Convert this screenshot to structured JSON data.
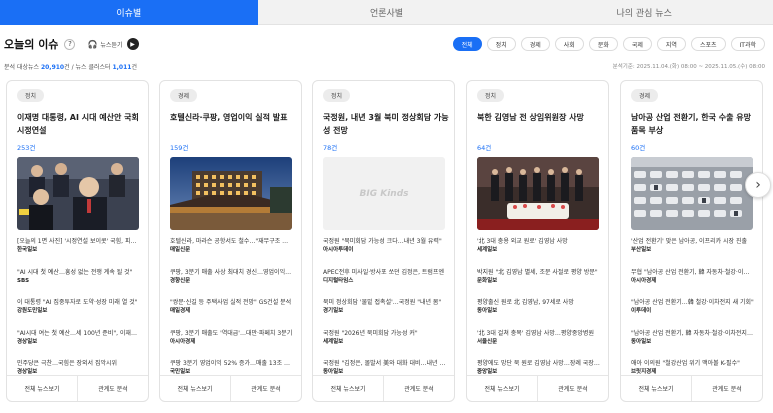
{
  "tabs": [
    {
      "label": "이슈별",
      "active": true
    },
    {
      "label": "언론사별",
      "active": false
    },
    {
      "label": "나의 관심 뉴스",
      "active": false
    }
  ],
  "heading": {
    "title": "오늘의 이슈",
    "help": "?",
    "listen": "뉴스듣기"
  },
  "categories": [
    "전체",
    "정치",
    "경제",
    "사회",
    "문화",
    "국제",
    "지역",
    "스포츠",
    "IT과학"
  ],
  "stats": {
    "label_news": "분석 대상뉴스",
    "news_count": "20,910",
    "label_cluster": "/ 뉴스 클러스터",
    "cluster_count": "1,011",
    "unit": "건",
    "basis": "분석기준: 2025.11.04.(화) 08:00 ~ 2025.11.05.(수) 08:00"
  },
  "footer": {
    "all_news": "전체 뉴스보기",
    "analysis": "관계도 분석"
  },
  "cards": [
    {
      "category": "정치",
      "title": "이재명 대통령, AI 시대 예산안 국회 시정연설",
      "count": "253건",
      "items": [
        {
          "headline": "[오늘의 1면 사진] '시정연설 보이콧' 국힘, 피켓 시위",
          "source": "한국일보"
        },
        {
          "headline": "\"AI 시대 첫 예산…흥성 없는 전쟁 계속 될 것\"",
          "source": "SBS"
        },
        {
          "headline": "이 대통령 \"AI 집중투자로 도약·성장 미래 열 것\"",
          "source": "강원도민일보"
        },
        {
          "headline": "\"AI시대 여는 첫 예산…세 100년 준비\", 이재명 대통령",
          "source": "경상일보"
        },
        {
          "headline": "민주당은 극찬…국힘은 장외서 집악시위",
          "source": "경상일보"
        }
      ]
    },
    {
      "category": "경제",
      "title": "호텔신라·쿠팡, 영업이익 실적 발표",
      "count": "159건",
      "items": [
        {
          "headline": "호텔신라, 마라슨 공항서도 철수…\"재무구조 개선\"",
          "source": "매일신문"
        },
        {
          "headline": "쿠팡, 3분기 매출 사상 최대치 경신…영업이익도 증가",
          "source": "경향신문"
        },
        {
          "headline": "\"쌍문·신길 등 주택사업 실적 전망\" GS건설 분석",
          "source": "매일경제"
        },
        {
          "headline": "쿠팡, 3분기 매출도 '역대급'…대만·파페치 3분기",
          "source": "아시아경제"
        },
        {
          "headline": "쿠팡 3분기 영업이익 52% 증가…매출 13조 육박",
          "source": "국민일보"
        }
      ]
    },
    {
      "category": "정치",
      "title": "국정원, 내년 3월 북미 정상회담 가능성 전망",
      "count": "78건",
      "thumb_text": "BIG Kinds",
      "items": [
        {
          "headline": "국정원 \"북미회담 가능성 크다…내년 3월 유력\"",
          "source": "아시아투데이"
        },
        {
          "headline": "APEC전후 미사일·방사포 쏘던 김정은, 트럼프엔",
          "source": "디지털타임스"
        },
        {
          "headline": "북미 정상회담 '물밑 접촉설'…국정원 \"내년 봄\"",
          "source": "경기일보"
        },
        {
          "headline": "국정원 \"2026년 북미회담 가능성 커\"",
          "source": "세계일보"
        },
        {
          "headline": "국정원 \"김정은, 몰발서 美와 대화 대비…내년 3월\"",
          "source": "동아일보"
        }
      ]
    },
    {
      "category": "정치",
      "title": "북한 김영남 전 상임위원장 사망",
      "count": "64건",
      "items": [
        {
          "headline": "'北 3대 충용 외교 원로' 김영남 사망",
          "source": "세계일보"
        },
        {
          "headline": "박지원 \"北 김영남 별세, 조문 사절로 평양 방문\"",
          "source": "문화일보"
        },
        {
          "headline": "평양출신 원로 北 김영남, 97세로 사망",
          "source": "동아일보"
        },
        {
          "headline": "'北 3대 걸쳐 충복' 김영남 사망…평양중앙병원",
          "source": "서울신문"
        },
        {
          "headline": "평양에도 망단 북 원로 김영남 사망…장례 국장으로",
          "source": "중앙일보"
        }
      ]
    },
    {
      "category": "경제",
      "title": "남아공 산업 전환기, 한국 수출 유망 품목 부상",
      "count": "60건",
      "items": [
        {
          "headline": "'산업 전환기' 맞은 남아공, 이프리카 시장 진출",
          "source": "부산일보"
        },
        {
          "headline": "무협 \"남아공 산업 전환기, 韓 자동차·철강·이차전지\"",
          "source": "아시아경제"
        },
        {
          "headline": "\"남아공 산업 전환기…韓 철강·이차전지 새 기회\"",
          "source": "이투데이"
        },
        {
          "headline": "\"남아공 산업 전환기, 韓 자동차·철강·이차전지 유망\"",
          "source": "동아일보"
        },
        {
          "headline": "애아 이의원 \"철강산업 위기 맥아볼 K-필수\"",
          "source": "브릿지경제"
        }
      ]
    }
  ]
}
